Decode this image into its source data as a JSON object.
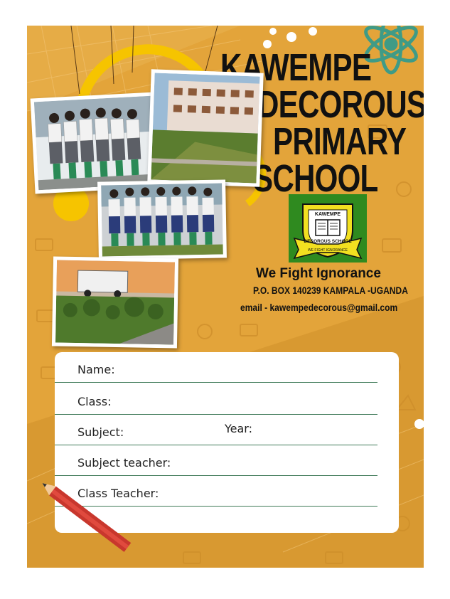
{
  "school": {
    "name_lines": [
      "KAWEMPE",
      "DECOROUS",
      "PRIMARY",
      "SCHOOL"
    ],
    "motto": "We Fight Ignorance",
    "address": "P.O. BOX 140239 KAMPALA -UGANDA",
    "email": "email - kawempedecorous@gmail.com"
  },
  "badge": {
    "top_text": "KAWEMPE",
    "ribbon_text": "DECOROUS   SCHOOL",
    "motto_text": "WE FIGHT IGNORANCE"
  },
  "photos": [
    {
      "name": "students-group-front-van"
    },
    {
      "name": "school-building-garden"
    },
    {
      "name": "students-line-up"
    },
    {
      "name": "school-van-garden"
    }
  ],
  "form": {
    "name_label": "Name:",
    "class_label": "Class:",
    "subject_label": "Subject:",
    "year_label": "Year:",
    "subject_teacher_label": "Subject teacher:",
    "class_teacher_label": "Class Teacher:"
  },
  "colors": {
    "background": "#e3a43a",
    "badge_green": "#2f8a1f",
    "badge_yellow": "#f2e020",
    "pencil_red": "#c8372d",
    "line_green": "#3f7a58"
  }
}
